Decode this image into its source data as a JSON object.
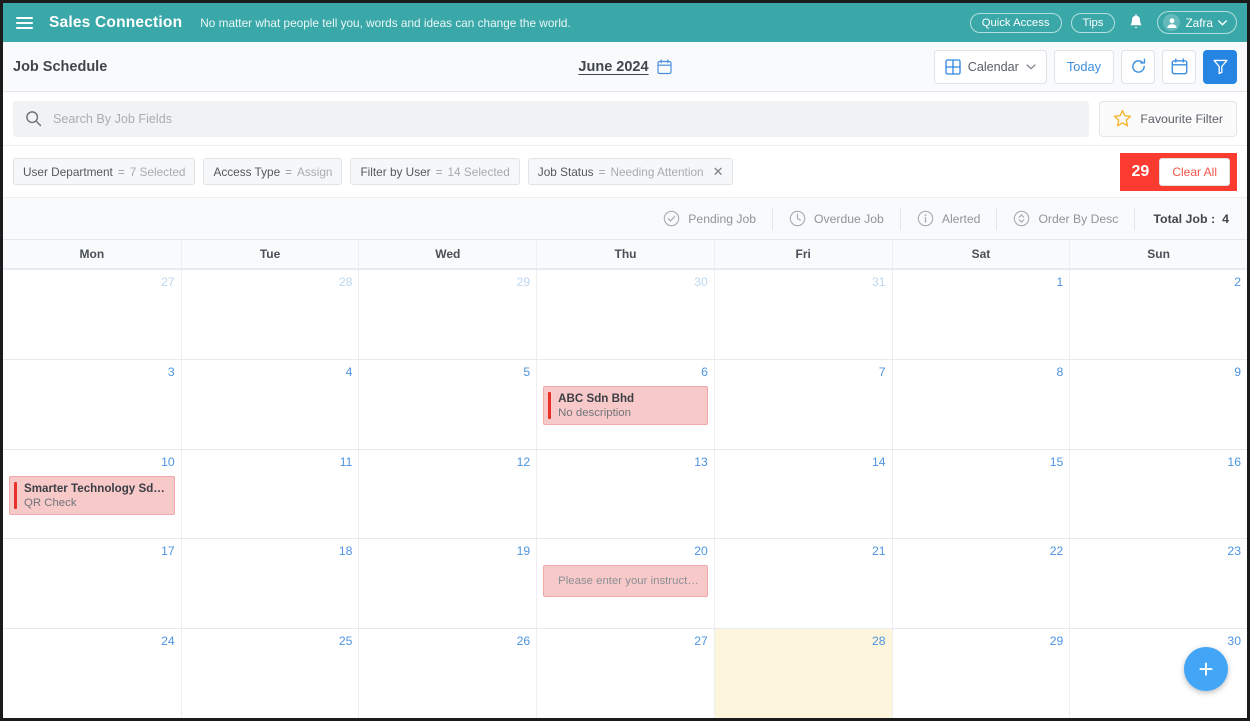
{
  "topbar": {
    "brand": "Sales Connection",
    "tagline": "No matter what people tell you, words and ideas can change the world.",
    "quick_access": "Quick Access",
    "tips": "Tips",
    "user": "Zafra"
  },
  "header": {
    "page_title": "Job Schedule",
    "month": "June 2024",
    "view_label": "Calendar",
    "today_label": "Today"
  },
  "search": {
    "placeholder": "Search By Job Fields",
    "favourite_filter": "Favourite Filter"
  },
  "filters": {
    "chips": [
      {
        "key": "User Department",
        "eq": "=",
        "value": "7 Selected",
        "closable": false
      },
      {
        "key": "Access Type",
        "eq": "=",
        "value": "Assign",
        "closable": false
      },
      {
        "key": "Filter by User",
        "eq": "=",
        "value": "14 Selected",
        "closable": false
      },
      {
        "key": "Job Status",
        "eq": "=",
        "value": "Needing Attention",
        "closable": true
      }
    ],
    "close_glyph": "✕",
    "annotation_number": "29",
    "clear_all": "Clear All",
    "annotation_color": "#fc3b30"
  },
  "stats": {
    "items": [
      {
        "icon": "check-circle-icon",
        "label": "Pending Job"
      },
      {
        "icon": "clock-icon",
        "label": "Overdue Job"
      },
      {
        "icon": "info-circle-icon",
        "label": "Alerted"
      },
      {
        "icon": "sort-circle-icon",
        "label": "Order By Desc"
      }
    ],
    "total_label": "Total Job :",
    "total_value": "4"
  },
  "calendar": {
    "daynames": [
      "Mon",
      "Tue",
      "Wed",
      "Thu",
      "Fri",
      "Sat",
      "Sun"
    ],
    "weeks": [
      [
        {
          "day": "27",
          "other": true,
          "today": false,
          "events": []
        },
        {
          "day": "28",
          "other": true,
          "today": false,
          "events": []
        },
        {
          "day": "29",
          "other": true,
          "today": false,
          "events": []
        },
        {
          "day": "30",
          "other": true,
          "today": false,
          "events": []
        },
        {
          "day": "31",
          "other": true,
          "today": false,
          "events": []
        },
        {
          "day": "1",
          "other": false,
          "today": false,
          "events": []
        },
        {
          "day": "2",
          "other": false,
          "today": false,
          "events": []
        }
      ],
      [
        {
          "day": "3",
          "other": false,
          "today": false,
          "events": []
        },
        {
          "day": "4",
          "other": false,
          "today": false,
          "events": []
        },
        {
          "day": "5",
          "other": false,
          "today": false,
          "events": []
        },
        {
          "day": "6",
          "other": false,
          "today": false,
          "events": [
            {
              "title": "ABC Sdn Bhd",
              "desc": "No description"
            }
          ]
        },
        {
          "day": "7",
          "other": false,
          "today": false,
          "events": []
        },
        {
          "day": "8",
          "other": false,
          "today": false,
          "events": []
        },
        {
          "day": "9",
          "other": false,
          "today": false,
          "events": []
        }
      ],
      [
        {
          "day": "10",
          "other": false,
          "today": false,
          "events": [
            {
              "title": "Smarter Technology Sdn Bh...",
              "desc": "QR Check"
            }
          ]
        },
        {
          "day": "11",
          "other": false,
          "today": false,
          "events": []
        },
        {
          "day": "12",
          "other": false,
          "today": false,
          "events": []
        },
        {
          "day": "13",
          "other": false,
          "today": false,
          "events": []
        },
        {
          "day": "14",
          "other": false,
          "today": false,
          "events": []
        },
        {
          "day": "15",
          "other": false,
          "today": false,
          "events": []
        },
        {
          "day": "16",
          "other": false,
          "today": false,
          "events": []
        }
      ],
      [
        {
          "day": "17",
          "other": false,
          "today": false,
          "events": []
        },
        {
          "day": "18",
          "other": false,
          "today": false,
          "events": []
        },
        {
          "day": "19",
          "other": false,
          "today": false,
          "events": []
        },
        {
          "day": "20",
          "other": false,
          "today": false,
          "events": [
            {
              "title": "",
              "desc": "Please enter your instruction..."
            }
          ]
        },
        {
          "day": "21",
          "other": false,
          "today": false,
          "events": []
        },
        {
          "day": "22",
          "other": false,
          "today": false,
          "events": []
        },
        {
          "day": "23",
          "other": false,
          "today": false,
          "events": []
        }
      ],
      [
        {
          "day": "24",
          "other": false,
          "today": false,
          "events": []
        },
        {
          "day": "25",
          "other": false,
          "today": false,
          "events": []
        },
        {
          "day": "26",
          "other": false,
          "today": false,
          "events": []
        },
        {
          "day": "27",
          "other": false,
          "today": false,
          "events": []
        },
        {
          "day": "28",
          "other": false,
          "today": true,
          "events": []
        },
        {
          "day": "29",
          "other": false,
          "today": false,
          "events": []
        },
        {
          "day": "30",
          "other": false,
          "today": false,
          "events": []
        }
      ]
    ]
  },
  "fab": {
    "glyph": "+"
  },
  "colors": {
    "brand_teal": "#3aa8a8",
    "accent_blue": "#2684e3",
    "event_pink": "#f8c9c9",
    "event_bar_red": "#e8312a",
    "alert_red": "#fc3b30",
    "today_yellow": "#fdf6dd"
  }
}
